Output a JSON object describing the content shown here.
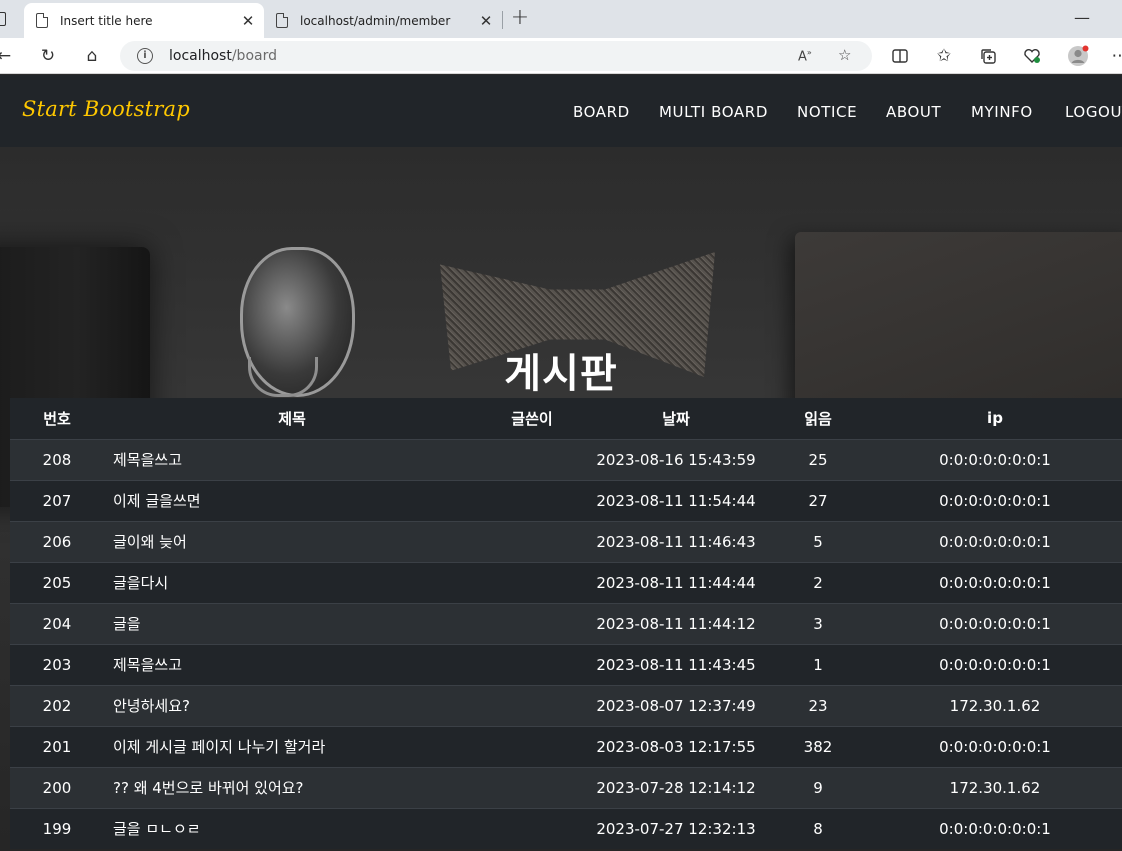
{
  "browser": {
    "tabs": [
      {
        "title": "Insert title here",
        "active": true
      },
      {
        "title": "localhost/admin/member",
        "active": false
      }
    ],
    "address": {
      "host": "localhost",
      "path": "/board"
    }
  },
  "navbar": {
    "brand": "Start Bootstrap",
    "items": [
      "BOARD",
      "MULTI BOARD",
      "NOTICE",
      "ABOUT",
      "MYINFO",
      "LOGOUT"
    ]
  },
  "hero": {
    "title": "게시판"
  },
  "table": {
    "headers": {
      "no": "번호",
      "title": "제목",
      "writer": "글쓴이",
      "date": "날짜",
      "read": "읽음",
      "ip": "ip"
    },
    "rows": [
      {
        "no": "208",
        "title": "제목을쓰고",
        "writer": "",
        "date": "2023-08-16 15:43:59",
        "read": "25",
        "ip": "0:0:0:0:0:0:0:1"
      },
      {
        "no": "207",
        "title": "이제 글을쓰면",
        "writer": "",
        "date": "2023-08-11 11:54:44",
        "read": "27",
        "ip": "0:0:0:0:0:0:0:1"
      },
      {
        "no": "206",
        "title": "글이왜 늦어",
        "writer": "",
        "date": "2023-08-11 11:46:43",
        "read": "5",
        "ip": "0:0:0:0:0:0:0:1"
      },
      {
        "no": "205",
        "title": "글을다시",
        "writer": "",
        "date": "2023-08-11 11:44:44",
        "read": "2",
        "ip": "0:0:0:0:0:0:0:1"
      },
      {
        "no": "204",
        "title": "글을",
        "writer": "",
        "date": "2023-08-11 11:44:12",
        "read": "3",
        "ip": "0:0:0:0:0:0:0:1"
      },
      {
        "no": "203",
        "title": "제목을쓰고",
        "writer": "",
        "date": "2023-08-11 11:43:45",
        "read": "1",
        "ip": "0:0:0:0:0:0:0:1"
      },
      {
        "no": "202",
        "title": "안녕하세요?",
        "writer": "",
        "date": "2023-08-07 12:37:49",
        "read": "23",
        "ip": "172.30.1.62"
      },
      {
        "no": "201",
        "title": "이제 게시글 페이지 나누기 할거라",
        "writer": "",
        "date": "2023-08-03 12:17:55",
        "read": "382",
        "ip": "0:0:0:0:0:0:0:1"
      },
      {
        "no": "200",
        "title": "?? 왜 4번으로 바뀌어 있어요?",
        "writer": "",
        "date": "2023-07-28 12:14:12",
        "read": "9",
        "ip": "172.30.1.62"
      },
      {
        "no": "199",
        "title": "글을 ㅁㄴㅇㄹ",
        "writer": "",
        "date": "2023-07-27 12:32:13",
        "read": "8",
        "ip": "0:0:0:0:0:0:0:1"
      }
    ]
  }
}
